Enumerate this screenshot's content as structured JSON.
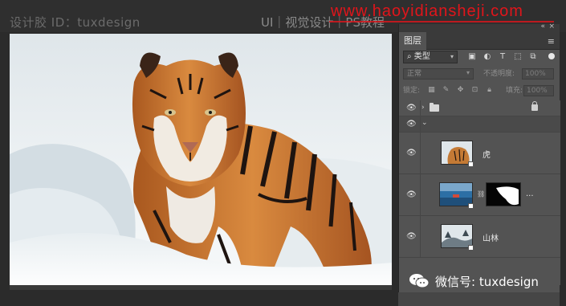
{
  "watermark": {
    "left": "设计胶 ID：tuxdesign",
    "center": "UI｜视觉设计｜PS教程",
    "url": "www.haoyidiansheji.com"
  },
  "panel": {
    "tab_label": "图层",
    "filter": {
      "kind_label": "类型",
      "icons": [
        "pixel-filter-icon",
        "adjustment-filter-icon",
        "type-filter-icon",
        "shape-filter-icon",
        "smart-object-filter-icon"
      ]
    },
    "blend_mode": "正常",
    "opacity_label": "不透明度:",
    "opacity_value": "100%",
    "lock_label": "锁定:",
    "fill_label": "填充:",
    "fill_value": "100%",
    "layers": [
      {
        "type": "group",
        "name": "",
        "visible": true,
        "locked": true
      },
      {
        "type": "group",
        "name": "",
        "visible": true,
        "expanded": true
      },
      {
        "type": "smart-object",
        "name": "虎",
        "visible": true
      },
      {
        "type": "smart-object-with-mask",
        "name": "...",
        "visible": true
      },
      {
        "type": "smart-object",
        "name": "山林",
        "visible": true
      }
    ]
  },
  "wechat": {
    "text": "微信号: tuxdesign"
  },
  "colors": {
    "panel_bg": "#535353",
    "panel_dark": "#3a3a3a",
    "watermark_url": "#e0151b"
  }
}
